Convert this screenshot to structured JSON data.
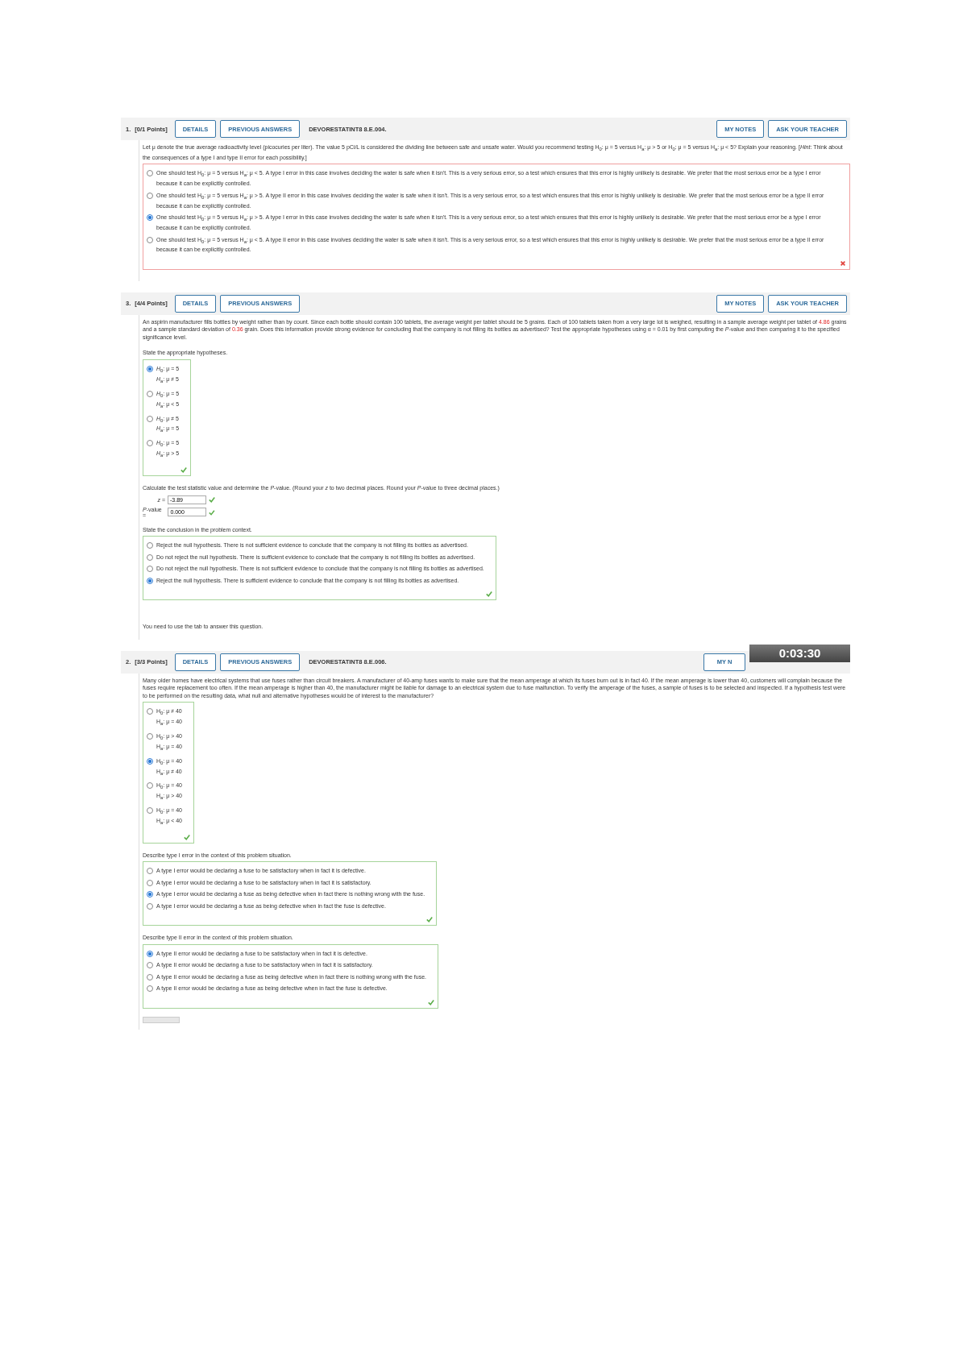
{
  "questions": [
    {
      "number": "1.",
      "points": "[0/1 Points]",
      "buttons": [
        "DETAILS",
        "PREVIOUS ANSWERS"
      ],
      "code": "DEVORESTATINT8 8.E.004.",
      "tools": [
        "MY NOTES",
        "ASK YOUR TEACHER"
      ],
      "parts": [
        {
          "kind": "text",
          "segments": [
            {
              "text": "Let μ denote the true average radioactivity level (picocuries per liter). The value 5 pCi/L is considered the dividing line between safe and unsafe water. Would you recommend testing H$_{0}$: μ = 5 versus H$_{a}$: μ > 5 or H$_{0}$: μ = 5 versus H$_{a}$: μ < 5? Explain your reasoning. [*Hint*: Think about the consequences of a type I and type II error for each possibility.]",
              "highlight": false
            }
          ]
        },
        {
          "kind": "choices",
          "correct": false,
          "options": [
            {
              "lines": [
                "One should test H$_{0}$: μ = 5 versus H$_{a}$: μ < 5. A type I error in this case involves deciding the water is safe when it isn't. This is a very serious error, so a test which ensures that this error is highly unlikely is desirable. We prefer that the most serious error be a type I error because it can be explicitly controlled."
              ],
              "selected": false
            },
            {
              "lines": [
                "One should test H$_{0}$: μ = 5 versus H$_{a}$: μ > 5. A type II error in this case involves deciding the water is safe when it isn't. This is a very serious error, so a test which ensures that this error is highly unlikely is desirable. We prefer that the most serious error be a type II error because it can be explicitly controlled."
              ],
              "selected": false
            },
            {
              "lines": [
                "One should test H$_{0}$: μ = 5 versus H$_{a}$: μ > 5. A type I error in this case involves deciding the water is safe when it isn't. This is a very serious error, so a test which ensures that this error is highly unlikely is desirable. We prefer that the most serious error be a type I error because it can be explicitly controlled."
              ],
              "selected": true
            },
            {
              "lines": [
                "One should test H$_{0}$: μ = 5 versus H$_{a}$: μ < 5. A type II error in this case involves deciding the water is safe when it isn't. This is a very serious error, so a test which ensures that this error is highly unlikely is desirable. We prefer that the most serious error be a type II error because it can be explicitly controlled."
              ],
              "selected": false
            }
          ]
        }
      ]
    },
    {
      "number": "3.",
      "points": "[4/4 Points]",
      "buttons": [
        "DETAILS",
        "PREVIOUS ANSWERS"
      ],
      "tools": [
        "MY NOTES",
        "ASK YOUR TEACHER"
      ],
      "parts": [
        {
          "kind": "text",
          "segments": [
            {
              "text": "An aspirin manufacturer fills bottles by weight rather than by count. Since each bottle should contain 100 tablets, the average weight per tablet should be 5 grains. Each of 100 tablets taken from a very large lot is weighed, resulting in a sample average weight per tablet of ",
              "highlight": false
            },
            {
              "text": "4.86",
              "highlight": true
            },
            {
              "text": " grains and a sample standard deviation of ",
              "highlight": false
            },
            {
              "text": "0.36",
              "highlight": true
            },
            {
              "text": " grain. Does this information provide strong evidence for concluding that the company is not filling its bottles as advertised? Test the appropriate hypotheses using α = 0.01 by first computing the *P*-value and then comparing it to the specified significance level.",
              "highlight": false
            }
          ]
        },
        {
          "kind": "prompt",
          "text": "State the appropriate hypotheses."
        },
        {
          "kind": "choices",
          "correct": true,
          "options": [
            {
              "lines": [
                "*H*$_{0}$: μ = 5",
                "*H*$_{a}$: μ ≠ 5"
              ],
              "selected": true
            },
            {
              "lines": [
                "*H*$_{0}$: μ = 5",
                "*H*$_{a}$: μ < 5"
              ],
              "selected": false
            },
            {
              "lines": [
                "*H*$_{0}$: μ ≠ 5",
                "*H*$_{a}$: μ = 5"
              ],
              "selected": false
            },
            {
              "lines": [
                "*H*$_{0}$: μ = 5",
                "*H*$_{a}$: μ > 5"
              ],
              "selected": false
            }
          ]
        },
        {
          "kind": "prompt",
          "text": "Calculate the test statistic value and determine the *P*-value. (Round your *z* to two decimal places. Round your *P*-value to three decimal places.)"
        },
        {
          "kind": "inputs",
          "rows": [
            {
              "label": "*z* =",
              "value": "-3.89",
              "correct": true
            },
            {
              "label": "*P*-value =",
              "value": "0.000",
              "correct": true
            }
          ]
        },
        {
          "kind": "prompt",
          "text": "State the conclusion in the problem context."
        },
        {
          "kind": "choices",
          "correct": true,
          "options": [
            {
              "lines": [
                "Reject the null hypothesis. There is not sufficient evidence to conclude that the company is not filling its bottles as advertised."
              ],
              "selected": false
            },
            {
              "lines": [
                "Do not reject the null hypothesis. There is sufficient evidence to conclude that the company is not filling its bottles as advertised."
              ],
              "selected": false
            },
            {
              "lines": [
                "Do not reject the null hypothesis. There is not sufficient evidence to conclude that the company is not filling its bottles as advertised."
              ],
              "selected": false
            },
            {
              "lines": [
                "Reject the null hypothesis. There is sufficient evidence to conclude that the company is not filling its bottles as advertised."
              ],
              "selected": true
            }
          ]
        },
        {
          "kind": "note",
          "text": "You need to use the tab to answer this question."
        }
      ]
    },
    {
      "number": "2.",
      "points": "[3/3 Points]",
      "buttons": [
        "DETAILS",
        "PREVIOUS ANSWERS"
      ],
      "code": "DEVORESTATINT8 8.E.006.",
      "tools": [
        "MY N"
      ],
      "timer": "0:03:30",
      "parts": [
        {
          "kind": "text",
          "segments": [
            {
              "text": "Many older homes have electrical systems that use fuses rather than circuit breakers. A manufacturer of 40-amp fuses wants to make sure that the mean amperage at which its fuses burn out is in fact 40. If the mean amperage is lower than 40, customers will complain because the fuses require replacement too often. If the mean amperage is higher than 40, the manufacturer might be liable for damage to an electrical system due to fuse malfunction. To verify the amperage of the fuses, a sample of fuses is to be selected and inspected. If a hypothesis test were to be performed on the resulting data, what null and alternative hypotheses would be of interest to the manufacturer?",
              "highlight": false
            }
          ]
        },
        {
          "kind": "choices",
          "correct": true,
          "options": [
            {
              "lines": [
                "H$_{0}$: μ ≠ 40",
                "H$_{a}$: μ = 40"
              ],
              "selected": false
            },
            {
              "lines": [
                "H$_{0}$: μ > 40",
                "H$_{a}$: μ = 40"
              ],
              "selected": false
            },
            {
              "lines": [
                "H$_{0}$: μ = 40",
                "H$_{a}$: μ ≠ 40"
              ],
              "selected": true
            },
            {
              "lines": [
                "H$_{0}$: μ = 40",
                "H$_{a}$: μ > 40"
              ],
              "selected": false
            },
            {
              "lines": [
                "H$_{0}$: μ = 40",
                "H$_{a}$: μ < 40"
              ],
              "selected": false
            }
          ]
        },
        {
          "kind": "prompt",
          "text": "Describe type I error in the context of this problem situation."
        },
        {
          "kind": "choices",
          "correct": true,
          "options": [
            {
              "lines": [
                "A type I error would be declaring a fuse to be satisfactory when in fact it is defective."
              ],
              "selected": false
            },
            {
              "lines": [
                "A type I error would be declaring a fuse to be satisfactory when in fact it is satisfactory."
              ],
              "selected": false
            },
            {
              "lines": [
                "A type I error would be declaring a fuse as being defective when in fact there is nothing wrong with the fuse."
              ],
              "selected": true
            },
            {
              "lines": [
                "A type I error would be declaring a fuse as being defective when in fact the fuse is defective."
              ],
              "selected": false
            }
          ]
        },
        {
          "kind": "prompt",
          "text": "Describe type II error in the context of this problem situation."
        },
        {
          "kind": "choices",
          "correct": true,
          "options": [
            {
              "lines": [
                "A type II error would be declaring a fuse to be satisfactory when in fact it is defective."
              ],
              "selected": true
            },
            {
              "lines": [
                "A type II error would be declaring a fuse to be satisfactory when in fact it is satisfactory."
              ],
              "selected": false
            },
            {
              "lines": [
                "A type II error would be declaring a fuse as being defective when in fact there is nothing wrong with the fuse."
              ],
              "selected": false
            },
            {
              "lines": [
                "A type II error would be declaring a fuse as being defective when in fact the fuse is defective."
              ],
              "selected": false
            }
          ]
        },
        {
          "kind": "submit"
        }
      ]
    }
  ]
}
